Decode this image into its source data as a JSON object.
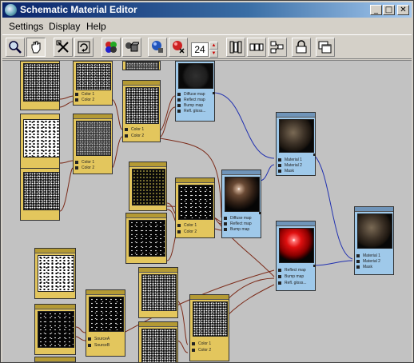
{
  "window": {
    "title": "Schematic Material Editor",
    "buttons": {
      "minimize": "_",
      "maximize": "□",
      "close": "✕"
    }
  },
  "menu": [
    "Settings",
    "Display",
    "Help"
  ],
  "toolbar": {
    "zoom_value": "24",
    "icons": [
      "zoom-icon",
      "pan-icon",
      "select-icon",
      "rotate-icon",
      "spheres-icon",
      "cube-icon",
      "sphere-cube-icon",
      "sphere-x-icon",
      "layout-icon",
      "columns-icon",
      "tree-icon",
      "lock-icon",
      "windows-icon"
    ]
  },
  "node_labels": {
    "color1": "Color 1",
    "color2": "Color 2",
    "diffuse": "Diffuse map",
    "reflect": "Reflect map",
    "bump": "Bump map",
    "refl_gloss": "Refl. gloss...",
    "material1": "Material 1",
    "material2": "Material 2",
    "mask": "Mask",
    "source_a": "SourceA",
    "source_b": "SourceB"
  },
  "colors": {
    "map_node": "#e3c65d",
    "material_node": "#9fc9ea",
    "viewport": "#c2c2c2",
    "map_wire": "#7b2a18",
    "material_wire": "#2030b0"
  }
}
